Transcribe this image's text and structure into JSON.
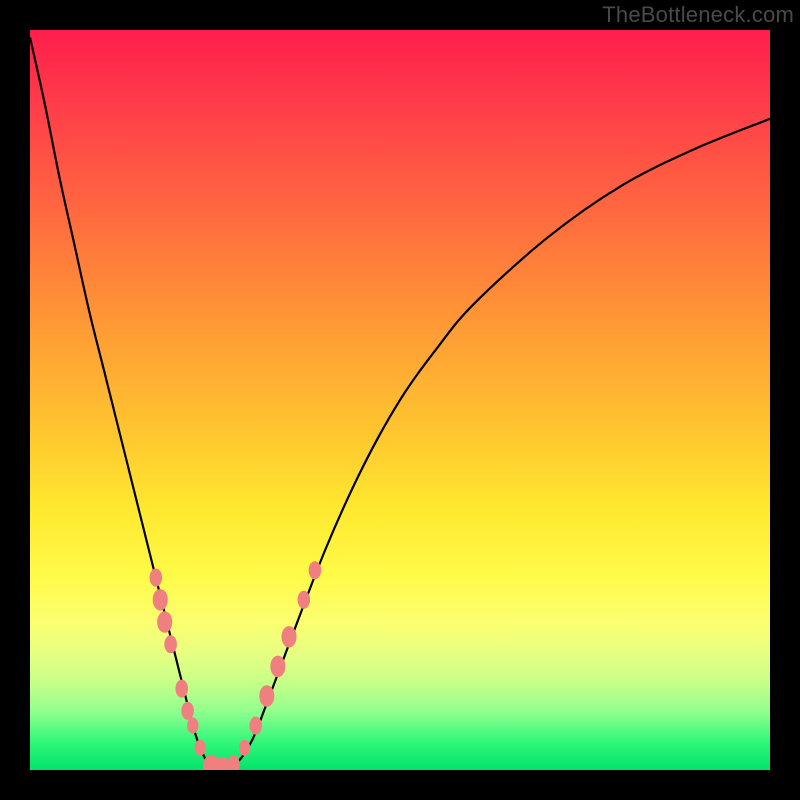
{
  "watermark": "TheBottleneck.com",
  "colors": {
    "frame": "#000000",
    "curve": "#000000",
    "marker": "#f08080",
    "gradient_top": "#ff1e4b",
    "gradient_bottom": "#00e46a"
  },
  "chart_data": {
    "type": "line",
    "title": "",
    "xlabel": "",
    "ylabel": "",
    "xlim": [
      0,
      100
    ],
    "ylim": [
      0,
      100
    ],
    "grid": false,
    "legend": "none",
    "annotations": [
      "TheBottleneck.com"
    ],
    "series": [
      {
        "name": "bottleneck-curve",
        "x": [
          0,
          2,
          4,
          6,
          8,
          10,
          12,
          14,
          16,
          18,
          20,
          21,
          22,
          23,
          24,
          25,
          26,
          28,
          30,
          32,
          35,
          40,
          45,
          50,
          55,
          60,
          70,
          80,
          90,
          100
        ],
        "y": [
          99,
          90,
          80,
          71,
          62,
          54,
          46,
          38,
          30,
          22,
          14,
          10,
          6,
          3,
          1,
          0,
          0,
          1,
          4,
          9,
          17,
          30,
          41,
          50,
          57,
          63,
          72,
          79,
          84,
          88
        ]
      }
    ],
    "markers": [
      {
        "x": 17.0,
        "y": 26,
        "r": 1.0
      },
      {
        "x": 17.6,
        "y": 23,
        "r": 1.2
      },
      {
        "x": 18.2,
        "y": 20,
        "r": 1.2
      },
      {
        "x": 19.0,
        "y": 17,
        "r": 1.0
      },
      {
        "x": 20.5,
        "y": 11,
        "r": 1.0
      },
      {
        "x": 21.3,
        "y": 8,
        "r": 1.0
      },
      {
        "x": 22.0,
        "y": 6,
        "r": 0.9
      },
      {
        "x": 23.0,
        "y": 3,
        "r": 0.9
      },
      {
        "x": 24.5,
        "y": 0.5,
        "r": 1.3
      },
      {
        "x": 26.0,
        "y": 0.2,
        "r": 1.3
      },
      {
        "x": 27.5,
        "y": 0.8,
        "r": 1.0
      },
      {
        "x": 29.0,
        "y": 3,
        "r": 0.9
      },
      {
        "x": 30.5,
        "y": 6,
        "r": 1.0
      },
      {
        "x": 32.0,
        "y": 10,
        "r": 1.2
      },
      {
        "x": 33.5,
        "y": 14,
        "r": 1.2
      },
      {
        "x": 35.0,
        "y": 18,
        "r": 1.2
      },
      {
        "x": 37.0,
        "y": 23,
        "r": 1.0
      },
      {
        "x": 38.5,
        "y": 27,
        "r": 1.0
      }
    ]
  }
}
